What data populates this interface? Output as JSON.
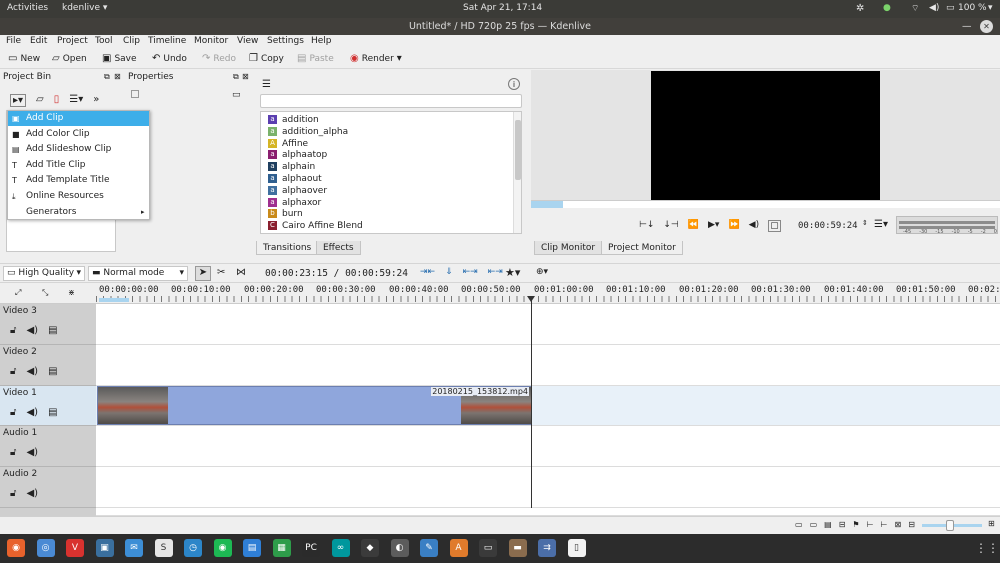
{
  "topbar": {
    "activities": "Activities",
    "app": "kdenlive ▾",
    "clock": "Sat Apr 21, 17:14",
    "battery": "100 %"
  },
  "window": {
    "title": "Untitled* / HD 720p 25 fps — Kdenlive"
  },
  "menu": [
    "File",
    "Edit",
    "Project",
    "Tool",
    "Clip",
    "Timeline",
    "Monitor",
    "View",
    "Settings",
    "Help"
  ],
  "toolbar": {
    "new": "New",
    "open": "Open",
    "save": "Save",
    "undo": "Undo",
    "redo": "Redo",
    "copy": "Copy",
    "paste": "Paste",
    "render": "Render"
  },
  "project_bin": {
    "title": "Project Bin",
    "properties": "Properties"
  },
  "add_menu": {
    "items": [
      "Add Clip",
      "Add Color Clip",
      "Add Slideshow Clip",
      "Add Title Clip",
      "Add Template Title",
      "Online Resources",
      "Generators"
    ]
  },
  "effects": {
    "items": [
      {
        "badge": "a",
        "color": "#5b3fb0",
        "label": "addition"
      },
      {
        "badge": "a",
        "color": "#7ab26b",
        "label": "addition_alpha"
      },
      {
        "badge": "A",
        "color": "#d5b526",
        "label": "Affine"
      },
      {
        "badge": "a",
        "color": "#8a1f6f",
        "label": "alphaatop"
      },
      {
        "badge": "a",
        "color": "#1f3f5f",
        "label": "alphain"
      },
      {
        "badge": "a",
        "color": "#2f5f8f",
        "label": "alphaout"
      },
      {
        "badge": "a",
        "color": "#3f6f9f",
        "label": "alphaover"
      },
      {
        "badge": "a",
        "color": "#9f2f8f",
        "label": "alphaxor"
      },
      {
        "badge": "b",
        "color": "#c98a1a",
        "label": "burn"
      },
      {
        "badge": "C",
        "color": "#8a1f2f",
        "label": "Cairo Affine Blend"
      }
    ],
    "tabs": [
      "Transitions",
      "Effects"
    ]
  },
  "monitor": {
    "timecode": "00:00:59:24",
    "tabs": [
      "Clip Monitor",
      "Project Monitor"
    ],
    "meter_labels": [
      "-45",
      "-30",
      "-15",
      "-10",
      "-5",
      "-2",
      "0"
    ]
  },
  "timeline_toolbar": {
    "quality": "High Quality",
    "mode": "Normal mode",
    "position": "00:00:23:15 / 00:00:59:24"
  },
  "ruler": [
    "00:00:00:00",
    "00:00:10:00",
    "00:00:20:00",
    "00:00:30:00",
    "00:00:40:00",
    "00:00:50:00",
    "00:01:00:00",
    "00:01:10:00",
    "00:01:20:00",
    "00:01:30:00",
    "00:01:40:00",
    "00:01:50:00",
    "00:02:"
  ],
  "tracks": [
    "Video 3",
    "Video 2",
    "Video 1",
    "Audio 1",
    "Audio 2"
  ],
  "clip": {
    "name": "20180215_153812.mp4"
  },
  "taskbar_apps": [
    "firefox",
    "chromium",
    "vivaldi",
    "screenshot",
    "thunderbird",
    "slack",
    "update",
    "spotify",
    "document",
    "spreadsheet",
    "pycharm",
    "arduino",
    "inkscape",
    "gimp",
    "pen",
    "archive",
    "terminal",
    "files",
    "kdenlive",
    "notes",
    "apps"
  ]
}
